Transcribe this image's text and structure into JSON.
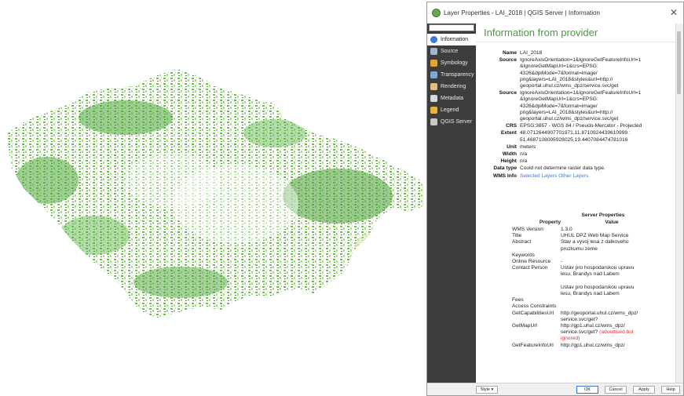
{
  "window": {
    "title": "Layer Properties - LAI_2018 | QGIS Server | Information"
  },
  "sidebar": {
    "items": [
      {
        "label": "Information",
        "icon": "info-icon",
        "color": "#3a7bd5"
      },
      {
        "label": "Source",
        "icon": "wrench-icon",
        "color": "#9fb7c9"
      },
      {
        "label": "Symbology",
        "icon": "paint-icon",
        "color": "#e2a23b"
      },
      {
        "label": "Transparency",
        "icon": "transparency-icon",
        "color": "#7ea6d8"
      },
      {
        "label": "Rendering",
        "icon": "brush-icon",
        "color": "#e0c080"
      },
      {
        "label": "Metadata",
        "icon": "document-icon",
        "color": "#d9d9d9"
      },
      {
        "label": "Legend",
        "icon": "legend-icon",
        "color": "#e8b24b"
      },
      {
        "label": "QGIS Server",
        "icon": "server-icon",
        "color": "#c8c8c8"
      }
    ]
  },
  "content": {
    "heading": "Information from provider",
    "props": [
      {
        "key": "Name",
        "value": "LAI_2018"
      },
      {
        "key": "Source",
        "value": "IgnoreAxisOrientation=1&IgnoreGetFeatureInfoUrl=1\n&IgnoreGetMapUrl=1&crs=EPSG:\n4326&dpiMode=7&format=image/\npng&layers=LAI_2018&styles&url=http://\ngeoportal.uhul.cz/wms_dpz/service.svc/get"
      },
      {
        "key": "Source",
        "value": "IgnoreAxisOrientation=1&IgnoreGetFeatureInfoUrl=1\n&IgnoreGetMapUrl=1&crs=EPSG:\n4326&dpiMode=7&format=image/\npng&layers=LAI_2018&styles&url=http://\ngeoportal.uhul.cz/wms_dpz/service.svc/get"
      },
      {
        "key": "CRS",
        "value": "EPSG:3857 - WGS 84 / Pseudo-Mercator - Projected"
      },
      {
        "key": "Extent",
        "value": "48.0712644907701971,11.8710924439610999 :\n51.4687108005928025,19.4407084474781016"
      },
      {
        "key": "Unit",
        "value": "meters"
      },
      {
        "key": "Width",
        "value": "n/a"
      },
      {
        "key": "Height",
        "value": "n/a"
      },
      {
        "key": "Data type",
        "value": "Could not determine raster data type."
      }
    ],
    "wms_info": {
      "key": "WMS Info",
      "link1": "Selected Layers",
      "link2": "Other Layers"
    },
    "server": {
      "title": "Server Properties",
      "col_property": "Property",
      "col_value": "Value",
      "rows": [
        {
          "p": "WMS Version",
          "v": "1.3.0"
        },
        {
          "p": "Title",
          "v": "UHUL DPZ Web Map Service"
        },
        {
          "p": "Abstract",
          "v": "Stav a vyvoj lesa z dalkoveho\npruzkumu zeme"
        },
        {
          "p": "Keywords",
          "v": ""
        },
        {
          "p": "Online Resource",
          "v": "-"
        },
        {
          "p": "Contact Person",
          "v": "Ustav pro hospodarskou upravu\nlesu, Brandys nad Labem\n\nUstav pro hospodarskou upravu\nlesu, Brandys nad Labem"
        },
        {
          "p": "Fees",
          "v": ""
        },
        {
          "p": "Access Constraints",
          "v": ""
        },
        {
          "p": "GetCapabilitiesUrl",
          "v": "http://geoportal.uhul.cz/wms_dpz/\nservice.svc/get?"
        },
        {
          "p": "GetMapUrl",
          "v": "http://gp1.uhul.cz/wms_dpz/\nservice.svc/get?",
          "note": "(advertised but\nignored)"
        },
        {
          "p": "GetFeatureInfoUrl",
          "v": "http://gp1.uhul.cz/wms_dpz/"
        }
      ]
    }
  },
  "footer": {
    "style": "Style",
    "ok": "OK",
    "cancel": "Cancel",
    "apply": "Apply",
    "help": "Help"
  }
}
